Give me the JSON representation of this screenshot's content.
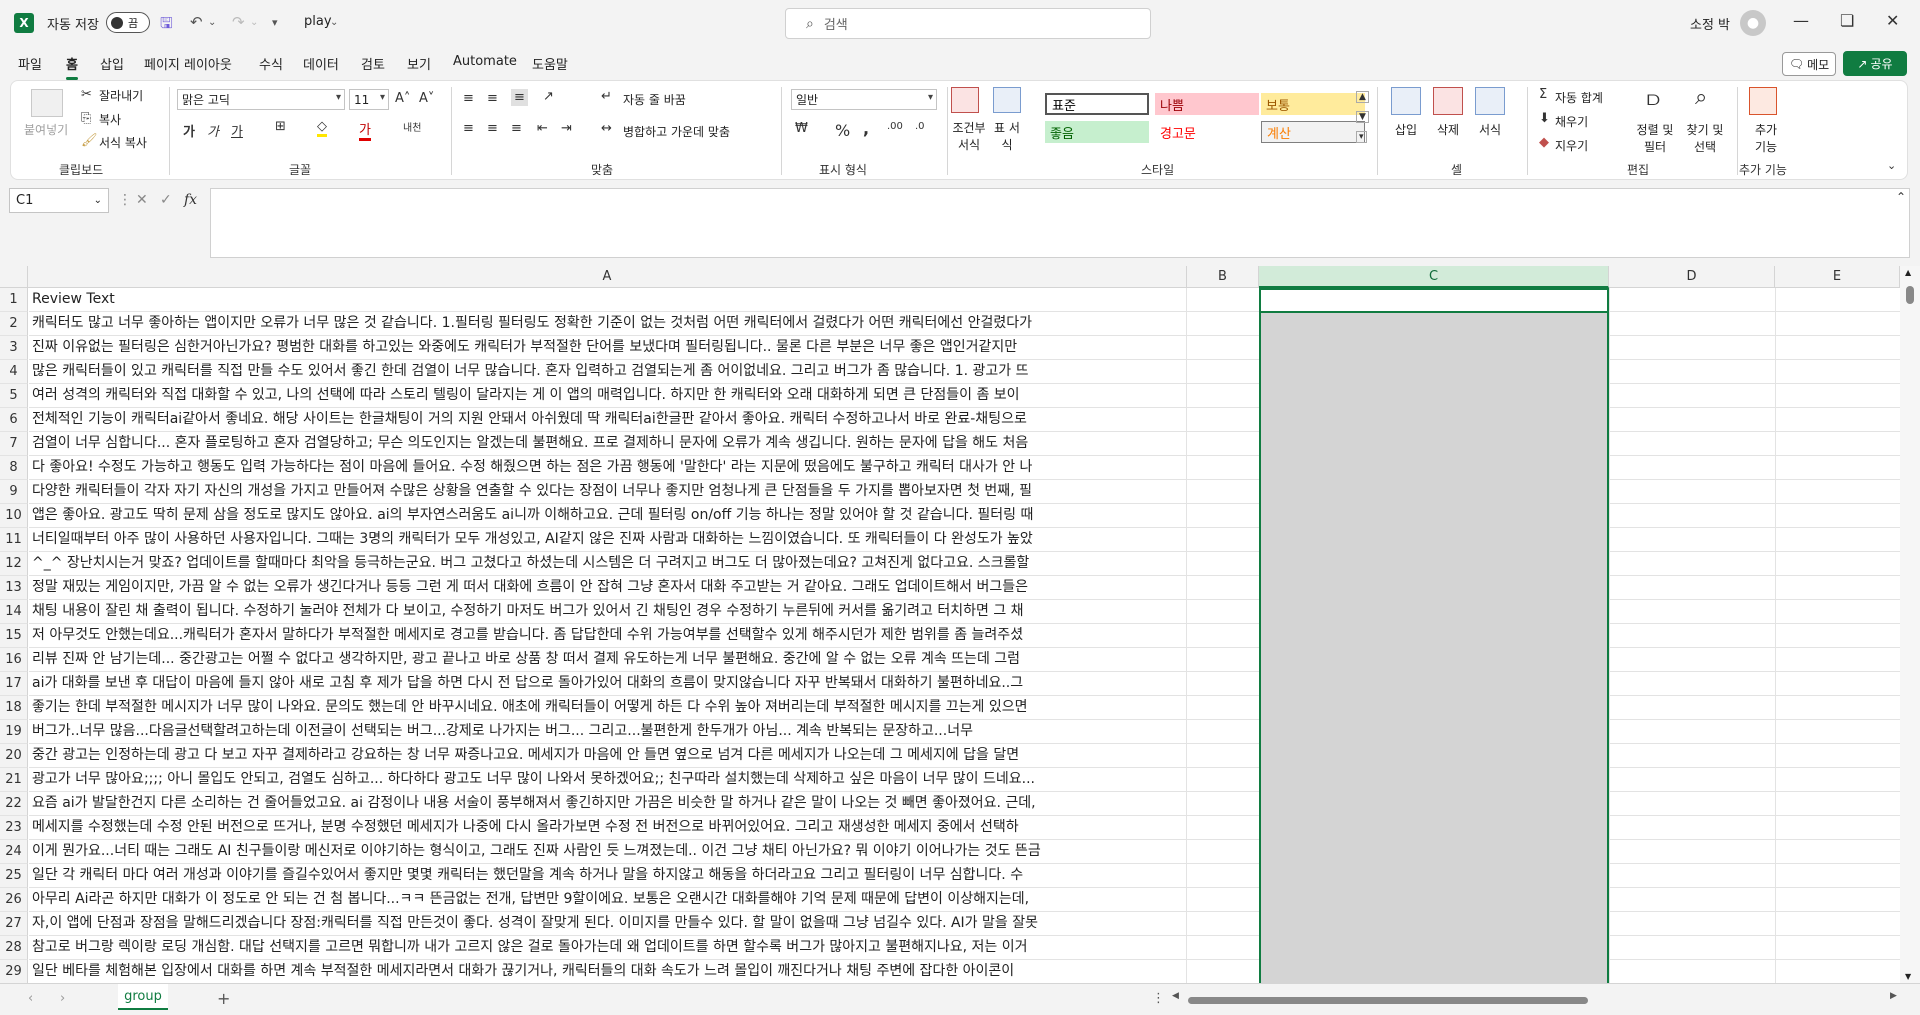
{
  "titlebar": {
    "app_logo": "X",
    "autosave_label": "자동 저장",
    "autosave_state": "끔",
    "filename": "play",
    "search_placeholder": "검색",
    "user_name": "소정 박"
  },
  "menu": {
    "items": [
      "파일",
      "홈",
      "삽입",
      "페이지 레이아웃",
      "수식",
      "데이터",
      "검토",
      "보기",
      "Automate",
      "도움말"
    ],
    "active": "홈",
    "memo": "메모",
    "share": "공유"
  },
  "ribbon": {
    "clipboard": {
      "paste": "붙여넣기",
      "cut": "잘라내기",
      "copy": "복사",
      "format_painter": "서식 복사",
      "label": "클립보드"
    },
    "font": {
      "name": "맑은 고딕",
      "size": "11",
      "label": "글꼴"
    },
    "alignment": {
      "wrap": "자동 줄 바꿈",
      "merge": "병합하고 가운데 맞춤",
      "label": "맞춤"
    },
    "number": {
      "format": "일반",
      "label": "표시 형식"
    },
    "styles": {
      "conditional": "조건부 서식",
      "table": "표 서식",
      "label": "스타일",
      "cells": [
        {
          "text": "표준",
          "bg": "#ffffff",
          "fg": "#000000"
        },
        {
          "text": "나쁨",
          "bg": "#ffc7ce",
          "fg": "#9c0006"
        },
        {
          "text": "보통",
          "bg": "#ffeb9c",
          "fg": "#9c5700"
        },
        {
          "text": "좋음",
          "bg": "#c6efce",
          "fg": "#006100"
        },
        {
          "text": "경고문",
          "bg": "#ffffff",
          "fg": "#ff0000"
        },
        {
          "text": "계산",
          "bg": "#f2f2f2",
          "fg": "#fa7d00"
        }
      ]
    },
    "cells": {
      "insert": "삽입",
      "delete": "삭제",
      "format": "서식",
      "label": "셀"
    },
    "editing": {
      "autosum": "자동 합계",
      "fill": "채우기",
      "clear": "지우기",
      "sort": "정렬 및 필터",
      "find": "찾기 및 선택",
      "label": "편집"
    },
    "addins": {
      "button": "추가 기능",
      "label": "추가 기능"
    }
  },
  "formula": {
    "namebox": "C1",
    "content": ""
  },
  "columns": [
    "A",
    "B",
    "C",
    "D",
    "E"
  ],
  "rows": [
    "Review Text",
    "캐릭터도 많고 너무 좋아하는 앱이지만 오류가 너무 많은 것 같습니다. 1.필터링 필터링도 정확한 기준이 없는 것처럼 어떤 캐릭터에서 걸렸다가 어떤 캐릭터에선 안걸렸다가",
    "진짜 이유없는 필터링은 심한거아닌가요? 평범한 대화를 하고있는 와중에도 캐릭터가 부적절한 단어를 보냈다며 필터링됩니다.. 물론 다른 부분은 너무 좋은 앱인거같지만",
    "많은 캐릭터들이 있고 캐릭터를 직접 만들 수도 있어서 좋긴 한데 검열이 너무 많습니다. 혼자 입력하고 검열되는게 좀 어이없네요. 그리고 버그가 좀 많습니다. 1. 광고가 뜨",
    "여러 성격의 캐릭터와 직접 대화할 수 있고, 나의 선택에 따라 스토리 텔링이 달라지는 게 이 앱의 매력입니다. 하지만 한 캐릭터와 오래 대화하게 되면 큰 단점들이 좀 보이",
    "전체적인 기능이 캐릭터ai같아서 좋네요. 해당 사이트는 한글채팅이 거의 지원 안돼서 아쉬웠데 딱 캐릭터ai한글판 같아서 좋아요. 캐릭터 수정하고나서 바로 완료-채팅으로",
    "검열이 너무 심합니다... 혼자 플로팅하고 혼자 검열당하고; 무슨 의도인지는 알겠는데 불편해요. 프로 결제하니 문자에 오류가 계속 생깁니다. 원하는 문자에 답을 해도 처음",
    "다 좋아요! 수정도 가능하고 행동도 입력 가능하다는 점이 마음에 들어요. 수정 해줬으면 하는 점은 가끔 행동에 '말한다' 라는 지문에 떴음에도 불구하고 캐릭터 대사가 안 나",
    "다양한 캐릭터들이 각자 자기 자신의 개성을 가지고 만들어져 수많은 상황을 연출할 수 있다는 장점이 너무나 좋지만 엄청나게 큰 단점들을 두 가지를 뽑아보자면 첫 번째, 필",
    "앱은 좋아요. 광고도 딱히 문제 삼을 정도로 많지도 않아요. ai의 부자연스러움도 ai니까 이해하고요. 근데 필터링 on/off 기능 하나는 정말 있어야 할 것 같습니다. 필터링 때",
    "너티일때부터 아주 많이 사용하던 사용자입니다. 그때는 3명의 캐릭터가 모두 개성있고, AI같지 않은 진짜 사람과 대화하는 느낌이였습니다. 또 캐릭터들이 다 완성도가 높았",
    "^_^ 장난치시는거 맞죠? 업데이트를 할때마다 최악을 등극하는군요. 버그 고쳤다고 하셨는데 시스템은 더 구려지고 버그도 더 많아졌는데요? 고쳐진게 없다고요. 스크롤할",
    "정말 재밌는 게임이지만, 가끔 알 수 없는 오류가 생긴다거나 등등 그런 게 떠서 대화에 흐름이 안 잡혀 그냥 혼자서 대화 주고받는 거 같아요. 그래도 업데이트해서 버그들은",
    "채팅 내용이 잘린 채 출력이 됩니다. 수정하기 눌러야 전체가 다 보이고, 수정하기 마저도 버그가 있어서 긴 채팅인 경우 수정하기 누른뒤에 커서를 옮기려고 터치하면 그 채",
    "저 아무것도 안했는데요...캐릭터가 혼자서 말하다가 부적절한 메세지로 경고를 받습니다. 좀 답답한데 수위 가능여부를 선택할수 있게 해주시던가 제한 범위를 좀 늘려주셨",
    "리뷰 진짜 안 남기는데... 중간광고는 어쩔 수 없다고 생각하지만, 광고 끝나고 바로 상품 창 떠서 결제 유도하는게 너무 불편해요. 중간에 알 수 없는 오류 계속 뜨는데 그럼",
    "ai가 대화를 보낸 후 대답이 마음에 들지 않아 새로 고침 후 제가 답을 하면 다시 전 답으로 돌아가있어 대화의 흐름이 맞지않습니다 자꾸 반복돼서 대화하기 불편하네요..그",
    "좋기는 한데 부적절한 메시지가 너무 많이 나와요. 문의도 했는데 안 바꾸시네요. 애초에 캐릭터들이 어떻게 하든 다 수위 높아 져버리는데 부적절한 메시지를 끄는게 있으면",
    "버그가..너무 많음...다음글선택할려고하는데 이전글이 선택되는 버그...강제로 나가지는 버그... 그리고...불편한게 한두개가 아님... 계속 반복되는 문장하고...너무",
    "중간 광고는 인정하는데 광고 다 보고 자꾸 결제하라고 강요하는 창 너무 짜증나고요. 메세지가 마음에 안 들면 옆으로 넘겨 다른 메세지가 나오는데 그 메세지에 답을 달면",
    "광고가 너무 많아요;;;; 아니 몰입도 안되고, 검열도 심하고... 하다하다 광고도 너무 많이 나와서 못하겠어요;; 친구따라 설치했는데 삭제하고 싶은 마음이 너무 많이 드네요...",
    "요즘 ai가 발달한건지 다른 소리하는 건 줄어들었고요. ai 감정이나 내용 서술이 풍부해져서 좋긴하지만 가끔은 비슷한 말 하거나 같은 말이 나오는 것 빼면 좋아졌어요. 근데,",
    "메세지를 수정했는데 수정 안된 버전으로 뜨거나, 분명 수정했던 메세지가 나중에 다시 올라가보면 수정 전 버전으로 바뀌어있어요. 그리고 재생성한 메세지 중에서 선택하",
    "이게 뭔가요...너티 때는 그래도 AI 친구들이랑 메신저로 이야기하는 형식이고, 그래도 진짜 사람인 듯 느껴졌는데.. 이건 그냥 채티 아닌가요? 뭐 이야기 이어나가는 것도 뜬금",
    "일단 각 캐릭터 마다 여러 개성과 이야기를 즐길수있어서 좋지만 몇몇 캐릭터는 했던말을 계속 하거나 말을 하지않고 해동을 하더라고요 그리고 필터링이 너무 심합니다. 수",
    "아무리 Ai라곤 하지만 대화가 이 정도로 안 되는 건 첨 봅니다...ㅋㅋ 뜬금없는 전개, 답변만 9할이에요. 보통은 오랜시간 대화를해야 기억 문제 때문에 답변이 이상해지는데,",
    "자,이 앱에 단점과 장점을 말해드리겠습니다 장점:캐릭터를 직접 만든것이 좋다. 성격이 잘맞게 된다. 이미지를 만들수 있다. 할 말이 없을때 그냥 넘길수 있다. AI가 말을 잘못",
    "참고로 버그랑 렉이랑 로딩 개심함. 대답 선택지를 고르면 뭐합니까 내가 고르지 않은 걸로 돌아가는데 왜 업데이트를 하면 할수록 버그가 많아지고 불편해지나요, 저는 이거",
    "일단 베타를 체험해본 입장에서 대화를 하면 계속 부적절한 메세지라면서 대화가 끊기거나, 캐릭터들의 대화 속도가 느려 몰입이 깨진다거나 채팅 주변에 잡다한 아이콘이"
  ],
  "sheets": [
    "group"
  ]
}
